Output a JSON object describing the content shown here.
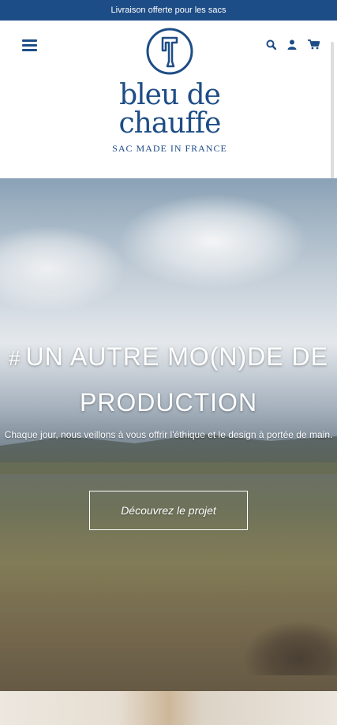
{
  "announcement": "Livraison offerte pour les sacs",
  "brand": {
    "name": "bleu de chauffe",
    "tagline": "SAC MADE IN FRANCE"
  },
  "header_icons": [
    "menu-icon",
    "search-icon",
    "user-icon",
    "cart-icon"
  ],
  "hero": {
    "title_hash": "#",
    "title": "UN AUTRE MO(N)DE DE PRODUCTION",
    "subtitle": "Chaque jour, nous veillons à vous offrir l'éthique et le design à portée de main.",
    "button": "Découvrez le projet"
  },
  "colors": {
    "brand_blue": "#1d4d86"
  }
}
